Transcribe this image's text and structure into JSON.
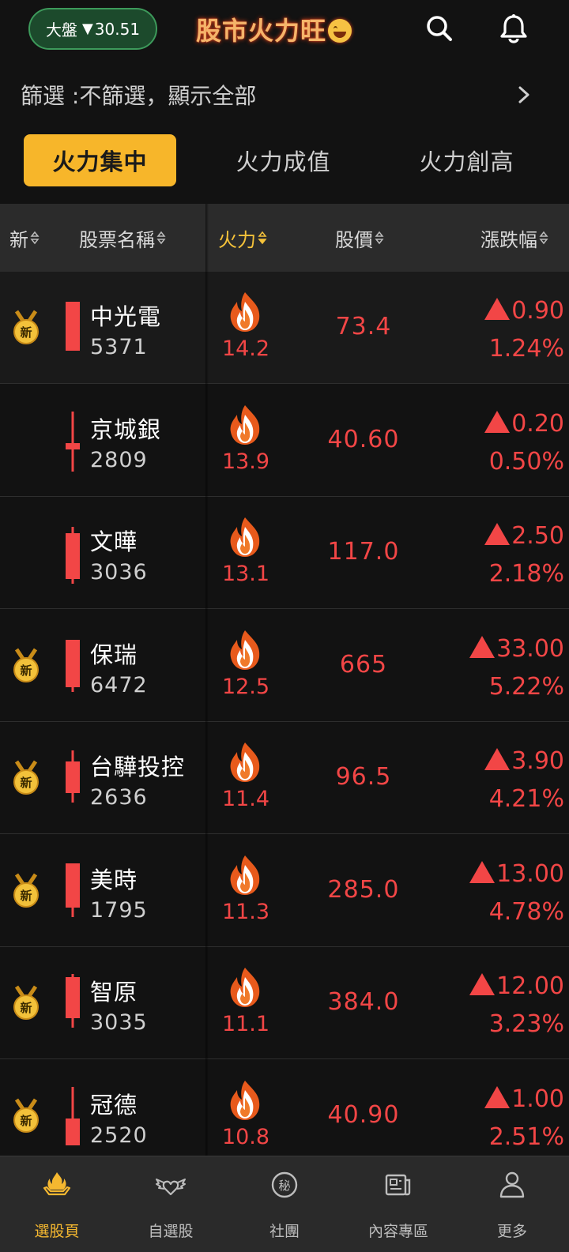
{
  "header": {
    "market_label": "大盤",
    "market_change": "30.51",
    "market_direction": "down",
    "app_title": "股市火力旺",
    "accent_color": "#f7b62a",
    "up_color": "#f24646",
    "icons": [
      "search-icon",
      "bell-icon"
    ]
  },
  "filter": {
    "text": "篩選 :不篩選，顯示全部"
  },
  "tabs": [
    {
      "label": "火力集中",
      "active": true
    },
    {
      "label": "火力成值",
      "active": false
    },
    {
      "label": "火力創高",
      "active": false
    }
  ],
  "columns": {
    "new": "新",
    "name": "股票名稱",
    "fire": "火力",
    "price": "股價",
    "change": "漲跌幅"
  },
  "stocks": [
    {
      "is_new": true,
      "name": "中光電",
      "code": "5371",
      "fire": "14.2",
      "price": "73.4",
      "change": "0.90",
      "pct": "1.24%"
    },
    {
      "is_new": false,
      "name": "京城銀",
      "code": "2809",
      "fire": "13.9",
      "price": "40.60",
      "change": "0.20",
      "pct": "0.50%"
    },
    {
      "is_new": false,
      "name": "文曄",
      "code": "3036",
      "fire": "13.1",
      "price": "117.0",
      "change": "2.50",
      "pct": "2.18%"
    },
    {
      "is_new": true,
      "name": "保瑞",
      "code": "6472",
      "fire": "12.5",
      "price": "665",
      "change": "33.00",
      "pct": "5.22%"
    },
    {
      "is_new": true,
      "name": "台驊投控",
      "code": "2636",
      "fire": "11.4",
      "price": "96.5",
      "change": "3.90",
      "pct": "4.21%"
    },
    {
      "is_new": true,
      "name": "美時",
      "code": "1795",
      "fire": "11.3",
      "price": "285.0",
      "change": "13.00",
      "pct": "4.78%"
    },
    {
      "is_new": true,
      "name": "智原",
      "code": "3035",
      "fire": "11.1",
      "price": "384.0",
      "change": "12.00",
      "pct": "3.23%"
    },
    {
      "is_new": true,
      "name": "冠德",
      "code": "2520",
      "fire": "10.8",
      "price": "40.90",
      "change": "1.00",
      "pct": "2.51%"
    }
  ],
  "medal_label": "新",
  "nav": [
    {
      "label": "選股頁",
      "icon": "fire-hand-icon",
      "active": true
    },
    {
      "label": "自選股",
      "icon": "winged-heart-icon",
      "active": false
    },
    {
      "label": "社團",
      "icon": "secret-badge-icon",
      "active": false,
      "badge_text": "秘"
    },
    {
      "label": "內容專區",
      "icon": "newspaper-icon",
      "active": false
    },
    {
      "label": "更多",
      "icon": "person-icon",
      "active": false
    }
  ]
}
